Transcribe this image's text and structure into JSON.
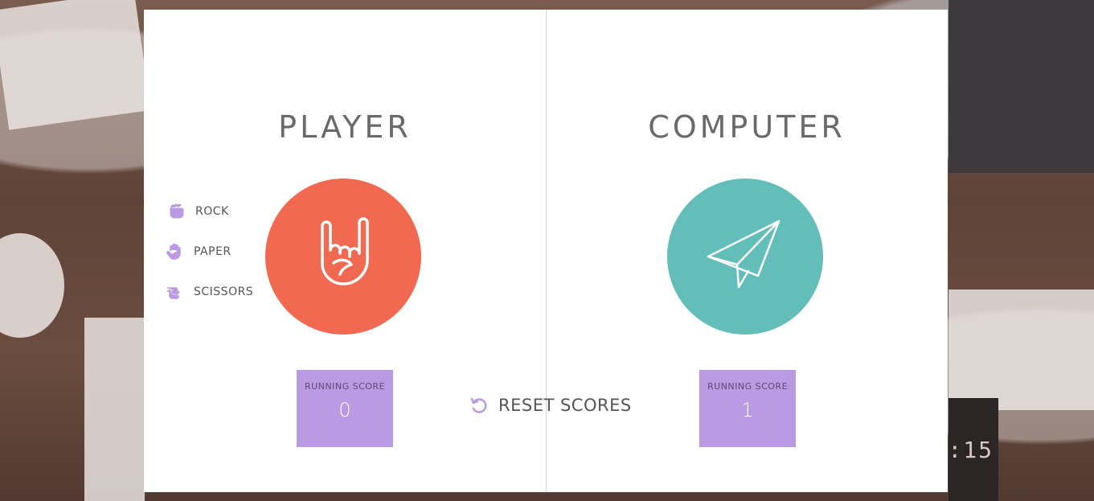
{
  "player": {
    "heading": "PLAYER",
    "choice_icon": "rock-on-hand-icon",
    "score_label": "RUNNING SCORE",
    "score_value": "0"
  },
  "computer": {
    "heading": "COMPUTER",
    "choice_icon": "paper-plane-icon",
    "score_label": "RUNNING SCORE",
    "score_value": "1"
  },
  "choices": [
    {
      "label": "ROCK",
      "icon": "fist-icon"
    },
    {
      "label": "PAPER",
      "icon": "open-hand-icon"
    },
    {
      "label": "SCISSORS",
      "icon": "scissors-hand-icon"
    }
  ],
  "reset": {
    "label": "RESET SCORES",
    "icon": "undo-icon"
  },
  "colors": {
    "player_circle": "#f16951",
    "computer_circle": "#63bdb9",
    "score_box": "#b99ae3",
    "accent_icon": "#b99ae3"
  }
}
